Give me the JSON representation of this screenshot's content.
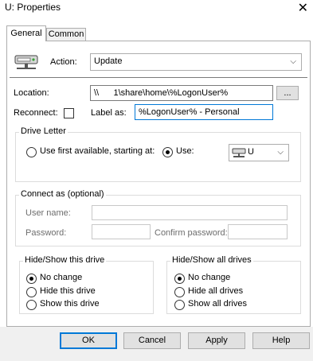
{
  "window": {
    "title": "U: Properties"
  },
  "tabs": [
    {
      "label": "General"
    },
    {
      "label": "Common"
    }
  ],
  "action": {
    "label": "Action:",
    "value": "Update"
  },
  "location": {
    "label": "Location:",
    "value": "\\\\      1\\share\\home\\%LogonUser%",
    "browse_label": "..."
  },
  "reconnect": {
    "label": "Reconnect:",
    "checked": false
  },
  "label_as": {
    "label": "Label as:",
    "value": "%LogonUser% - Personal"
  },
  "drive_letter": {
    "legend": "Drive Letter",
    "option_first": "Use first available, starting at:",
    "option_use": "Use:",
    "selected_drive": "U"
  },
  "connect_as": {
    "legend": "Connect as (optional)",
    "user_name_label": "User name:",
    "password_label": "Password:",
    "confirm_password_label": "Confirm password:"
  },
  "hide_show_drive": {
    "legend": "Hide/Show this drive",
    "options": [
      "No change",
      "Hide this drive",
      "Show this drive"
    ],
    "selected_index": 0
  },
  "hide_show_all": {
    "legend": "Hide/Show all drives",
    "options": [
      "No change",
      "Hide all drives",
      "Show all drives"
    ],
    "selected_index": 0
  },
  "buttons": {
    "ok": "OK",
    "cancel": "Cancel",
    "apply": "Apply",
    "help": "Help"
  }
}
